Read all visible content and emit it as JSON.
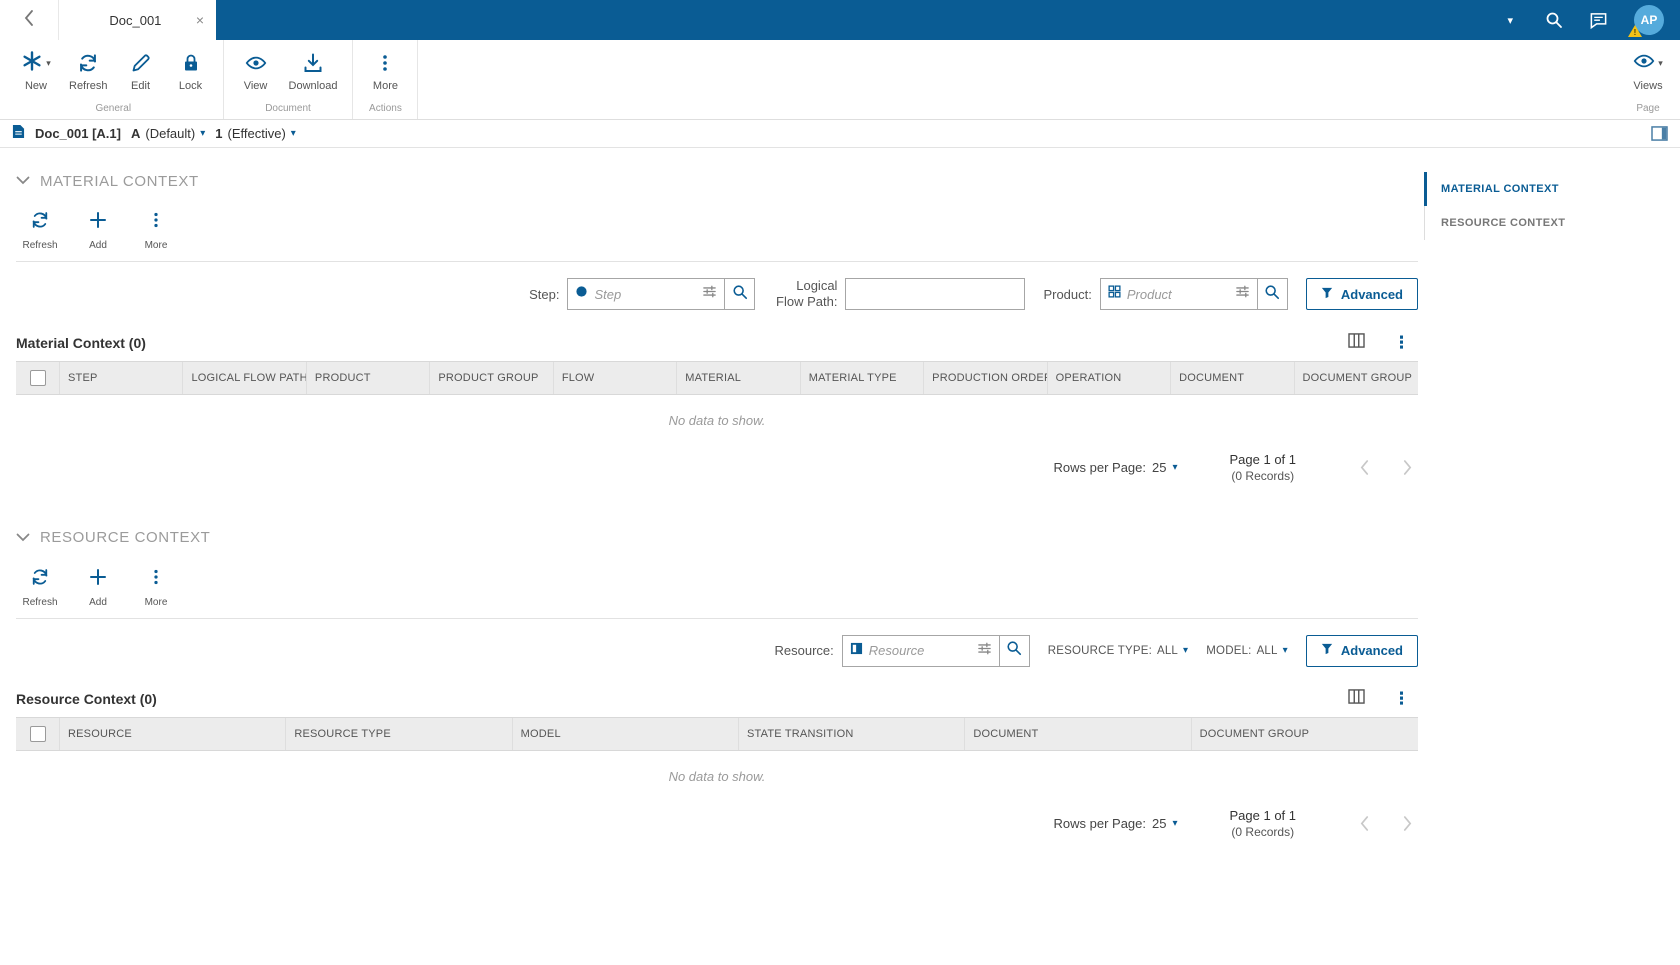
{
  "colors": {
    "topbar": "#0a5c94",
    "accent": "#0a5c94",
    "table_header_bg": "#ececec",
    "warning_badge": "#f2c117"
  },
  "icons": {
    "caret_down": "▾",
    "close": "×",
    "ellipsis_vertical": "⋮"
  },
  "topbar": {
    "tab_title": "Doc_001",
    "avatar_initials": "AP",
    "warning_badge": "!"
  },
  "ribbon": {
    "new_label": "New",
    "refresh_label": "Refresh",
    "edit_label": "Edit",
    "lock_label": "Lock",
    "general_group_label": "General",
    "view_label": "View",
    "download_label": "Download",
    "document_group_label": "Document",
    "more_label": "More",
    "actions_group_label": "Actions",
    "views_label": "Views",
    "page_group_label": "Page"
  },
  "breadcrumb": {
    "document_title": "Doc_001 [A.1]",
    "revision_value": "A",
    "revision_qualifier": "(Default)",
    "version_value": "1",
    "version_qualifier": "(Effective)"
  },
  "sidebar": {
    "items": [
      {
        "label": "MATERIAL CONTEXT"
      },
      {
        "label": "RESOURCE CONTEXT"
      }
    ]
  },
  "material_section": {
    "title": "MATERIAL CONTEXT",
    "toolbar": {
      "refresh_label": "Refresh",
      "add_label": "Add",
      "more_label": "More"
    },
    "filters": {
      "step_label": "Step:",
      "step_placeholder": "Step",
      "logical_flow_path_label": "Logical Flow Path:",
      "product_label": "Product:",
      "product_placeholder": "Product",
      "advanced_label": "Advanced"
    },
    "table": {
      "title": "Material Context (0)",
      "columns": [
        "STEP",
        "LOGICAL FLOW PATH",
        "PRODUCT",
        "PRODUCT GROUP",
        "FLOW",
        "MATERIAL",
        "MATERIAL TYPE",
        "PRODUCTION ORDER",
        "OPERATION",
        "DOCUMENT",
        "DOCUMENT GROUP"
      ],
      "empty_message": "No data to show.",
      "pagination": {
        "rows_per_page_label": "Rows per Page:",
        "rows_per_page_value": "25",
        "page_text": "Page 1 of 1",
        "records_text": "(0 Records)"
      }
    }
  },
  "resource_section": {
    "title": "RESOURCE CONTEXT",
    "toolbar": {
      "refresh_label": "Refresh",
      "add_label": "Add",
      "more_label": "More"
    },
    "filters": {
      "resource_label": "Resource:",
      "resource_placeholder": "Resource",
      "resource_type_label": "RESOURCE TYPE:",
      "resource_type_value": "ALL",
      "model_label": "MODEL:",
      "model_value": "ALL",
      "advanced_label": "Advanced"
    },
    "table": {
      "title": "Resource Context (0)",
      "columns": [
        "RESOURCE",
        "RESOURCE TYPE",
        "MODEL",
        "STATE TRANSITION",
        "DOCUMENT",
        "DOCUMENT GROUP"
      ],
      "empty_message": "No data to show.",
      "pagination": {
        "rows_per_page_label": "Rows per Page:",
        "rows_per_page_value": "25",
        "page_text": "Page 1 of 1",
        "records_text": "(0 Records)"
      }
    }
  }
}
